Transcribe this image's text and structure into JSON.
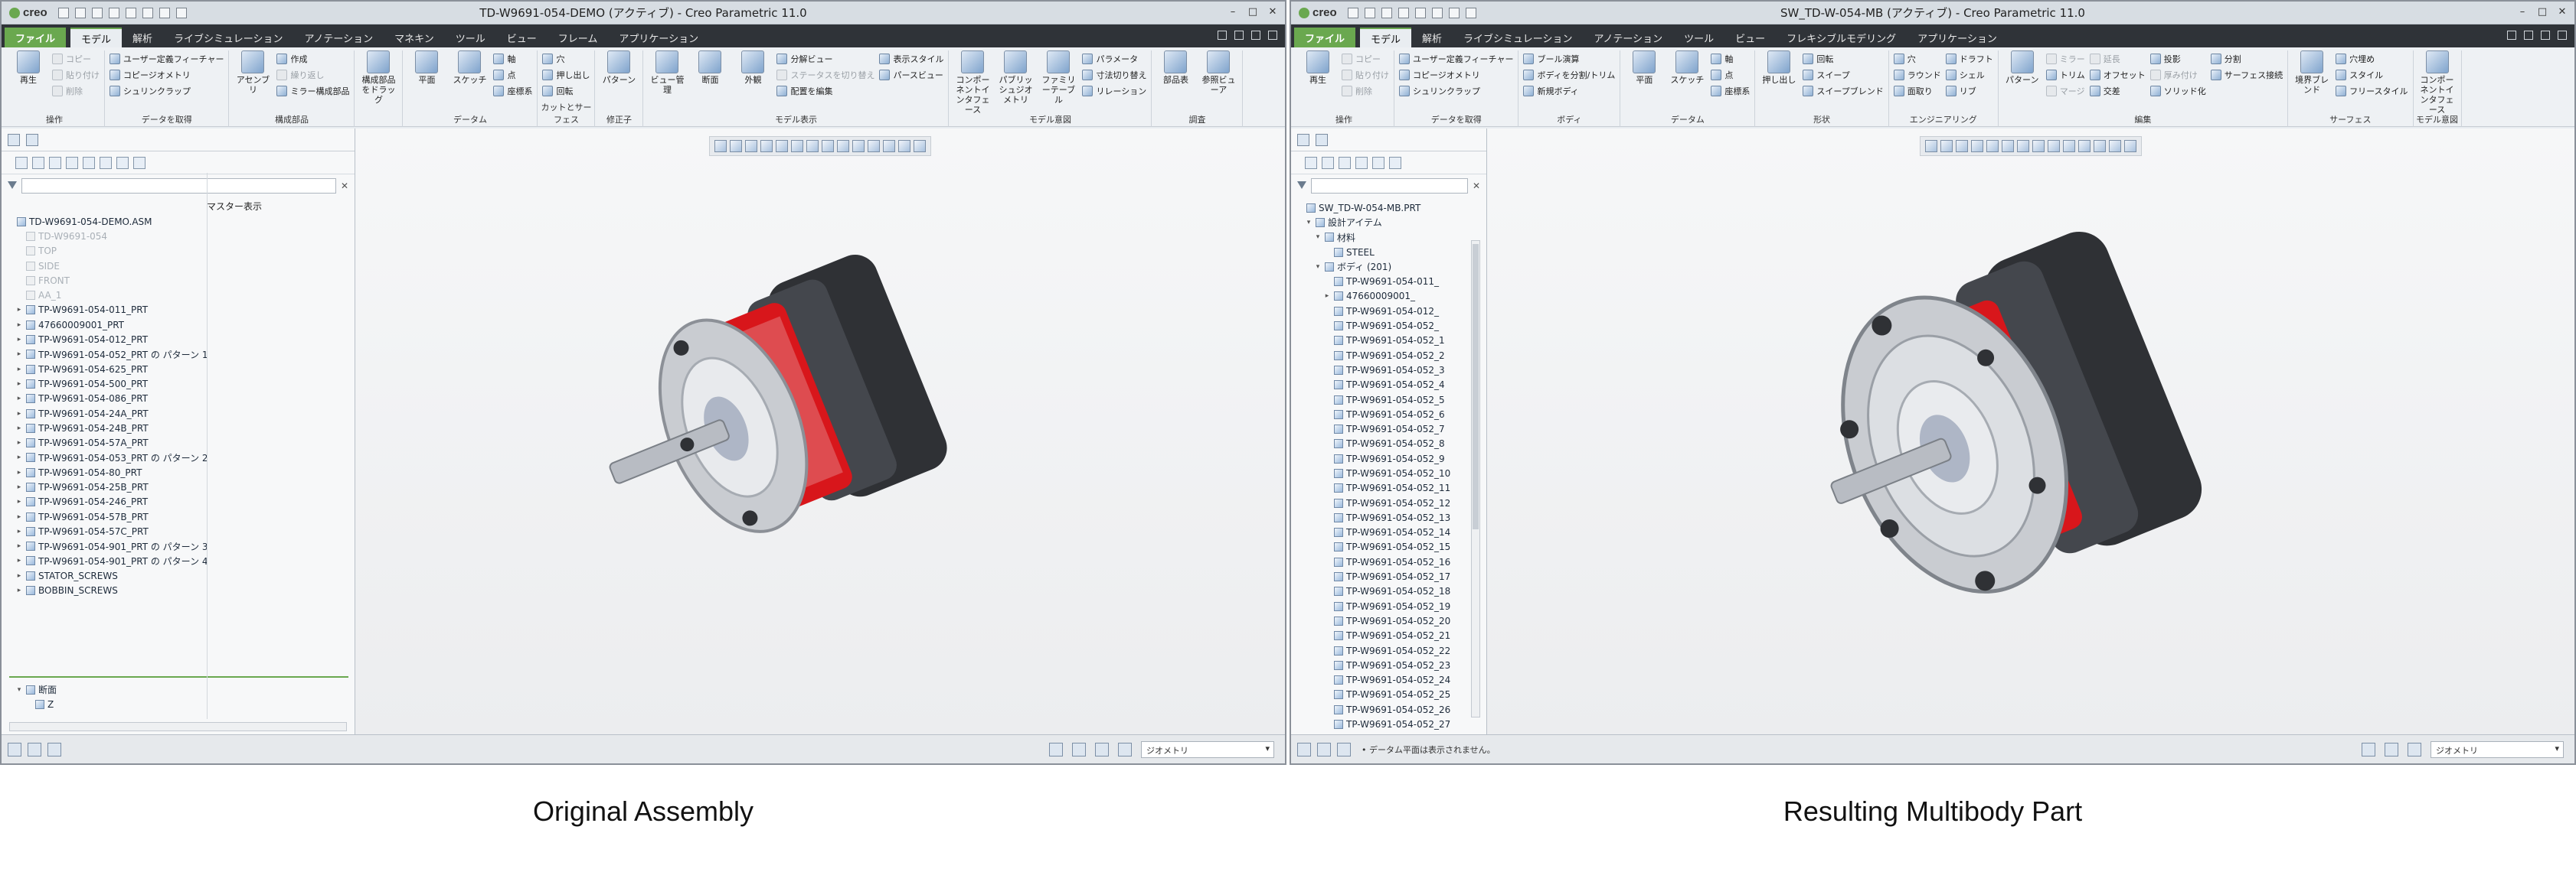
{
  "left_window": {
    "app": "creo",
    "title": "TD-W9691-054-DEMO (アクティブ) - Creo Parametric 11.0",
    "tabs": [
      {
        "label": "ファイル"
      },
      {
        "label": "モデル"
      },
      {
        "label": "解析"
      },
      {
        "label": "ライブシミュレーション"
      },
      {
        "label": "アノテーション"
      },
      {
        "label": "マネキン"
      },
      {
        "label": "ツール"
      },
      {
        "label": "ビュー"
      },
      {
        "label": "フレーム"
      },
      {
        "label": "アプリケーション"
      }
    ],
    "ribbon_groups": [
      {
        "label": "操作",
        "big": [
          {
            "label": "再生"
          }
        ],
        "small": [
          {
            "label": "コピー",
            "dim": true
          },
          {
            "label": "貼り付け",
            "dim": true
          },
          {
            "label": "削除",
            "dim": true
          }
        ]
      },
      {
        "label": "データを取得",
        "big": [],
        "small": [
          {
            "label": "ユーザー定義フィーチャー"
          },
          {
            "label": "コピージオメトリ"
          },
          {
            "label": "シュリンクラップ"
          }
        ]
      },
      {
        "label": "構成部品",
        "big": [
          {
            "label": "アセンブリ"
          }
        ],
        "small": [
          {
            "label": "作成"
          },
          {
            "label": "繰り返し",
            "dim": true
          },
          {
            "label": "ミラー構成部品"
          }
        ]
      },
      {
        "label": "",
        "big": [
          {
            "label": "構成部品をドラッグ"
          }
        ],
        "small": []
      },
      {
        "label": "データム",
        "big": [
          {
            "label": "平面"
          },
          {
            "label": "スケッチ"
          }
        ],
        "small": [
          {
            "label": "軸"
          },
          {
            "label": "点"
          },
          {
            "label": "座標系"
          }
        ]
      },
      {
        "label": "カットとサーフェス",
        "big": [],
        "small": [
          {
            "label": "穴"
          },
          {
            "label": "押し出し"
          },
          {
            "label": "回転"
          }
        ]
      },
      {
        "label": "修正子",
        "big": [
          {
            "label": "パターン"
          }
        ],
        "small": []
      },
      {
        "label": "モデル表示",
        "big": [
          {
            "label": "ビュー管理"
          },
          {
            "label": "断面"
          },
          {
            "label": "外観"
          }
        ],
        "small": [
          {
            "label": "分解ビュー"
          },
          {
            "label": "ステータスを切り替え",
            "dim": true
          },
          {
            "label": "配置を編集"
          },
          {
            "label": "表示スタイル"
          },
          {
            "label": "パースビュー"
          }
        ]
      },
      {
        "label": "モデル意図",
        "big": [
          {
            "label": "コンポーネントインタフェース"
          },
          {
            "label": "パブリッシュジオメトリ"
          },
          {
            "label": "ファミリーテーブル"
          }
        ],
        "small": [
          {
            "label": "パラメータ"
          },
          {
            "label": "寸法切り替え"
          },
          {
            "label": "リレーション"
          }
        ]
      },
      {
        "label": "調査",
        "big": [
          {
            "label": "部品表"
          },
          {
            "label": "参照ビューア"
          }
        ],
        "small": []
      }
    ],
    "tree_column_header": "マスター表示",
    "tree": [
      {
        "label": "TD-W9691-054-DEMO.ASM",
        "arrow": "",
        "ghost": false,
        "indent": 0
      },
      {
        "label": "TD-W9691-054",
        "arrow": "",
        "ghost": true,
        "indent": 1
      },
      {
        "label": "TOP",
        "arrow": "",
        "ghost": true,
        "indent": 1
      },
      {
        "label": "SIDE",
        "arrow": "",
        "ghost": true,
        "indent": 1
      },
      {
        "label": "FRONT",
        "arrow": "",
        "ghost": true,
        "indent": 1
      },
      {
        "label": "AA_1",
        "arrow": "",
        "ghost": true,
        "indent": 1
      },
      {
        "label": "TP-W9691-054-011_PRT",
        "arrow": "▸",
        "ghost": false,
        "indent": 1
      },
      {
        "label": "47660009001_PRT",
        "arrow": "▸",
        "ghost": false,
        "indent": 1
      },
      {
        "label": "TP-W9691-054-012_PRT",
        "arrow": "▸",
        "ghost": false,
        "indent": 1
      },
      {
        "label": "TP-W9691-054-052_PRT の パターン 1",
        "arrow": "▸",
        "ghost": false,
        "indent": 1
      },
      {
        "label": "TP-W9691-054-625_PRT",
        "arrow": "▸",
        "ghost": false,
        "indent": 1
      },
      {
        "label": "TP-W9691-054-500_PRT",
        "arrow": "▸",
        "ghost": false,
        "indent": 1
      },
      {
        "label": "TP-W9691-054-086_PRT",
        "arrow": "▸",
        "ghost": false,
        "indent": 1
      },
      {
        "label": "TP-W9691-054-24A_PRT",
        "arrow": "▸",
        "ghost": false,
        "indent": 1
      },
      {
        "label": "TP-W9691-054-24B_PRT",
        "arrow": "▸",
        "ghost": false,
        "indent": 1
      },
      {
        "label": "TP-W9691-054-57A_PRT",
        "arrow": "▸",
        "ghost": false,
        "indent": 1
      },
      {
        "label": "TP-W9691-054-053_PRT の パターン 2",
        "arrow": "▸",
        "ghost": false,
        "indent": 1
      },
      {
        "label": "TP-W9691-054-80_PRT",
        "arrow": "▸",
        "ghost": false,
        "indent": 1
      },
      {
        "label": "TP-W9691-054-25B_PRT",
        "arrow": "▸",
        "ghost": false,
        "indent": 1
      },
      {
        "label": "TP-W9691-054-246_PRT",
        "arrow": "▸",
        "ghost": false,
        "indent": 1
      },
      {
        "label": "TP-W9691-054-57B_PRT",
        "arrow": "▸",
        "ghost": false,
        "indent": 1
      },
      {
        "label": "TP-W9691-054-57C_PRT",
        "arrow": "▸",
        "ghost": false,
        "indent": 1
      },
      {
        "label": "TP-W9691-054-901_PRT の パターン 3",
        "arrow": "▸",
        "ghost": false,
        "indent": 1
      },
      {
        "label": "TP-W9691-054-901_PRT の パターン 4",
        "arrow": "▸",
        "ghost": false,
        "indent": 1
      },
      {
        "label": "STATOR_SCREWS",
        "arrow": "▸",
        "ghost": false,
        "indent": 1
      },
      {
        "label": "BOBBIN_SCREWS",
        "arrow": "▸",
        "ghost": false,
        "indent": 1
      }
    ],
    "section_tree": [
      {
        "label": "断面",
        "arrow": "▾",
        "ghost": false,
        "indent": 1
      },
      {
        "label": "Z",
        "arrow": "",
        "ghost": false,
        "indent": 2
      }
    ],
    "status_message": "",
    "filter_value": "ジオメトリ"
  },
  "right_window": {
    "app": "creo",
    "title": "SW_TD-W-054-MB (アクティブ) - Creo Parametric 11.0",
    "tabs": [
      {
        "label": "ファイル"
      },
      {
        "label": "モデル"
      },
      {
        "label": "解析"
      },
      {
        "label": "ライブシミュレーション"
      },
      {
        "label": "アノテーション"
      },
      {
        "label": "ツール"
      },
      {
        "label": "ビュー"
      },
      {
        "label": "フレキシブルモデリング"
      },
      {
        "label": "アプリケーション"
      }
    ],
    "ribbon_groups": [
      {
        "label": "操作",
        "big": [
          {
            "label": "再生"
          }
        ],
        "small": [
          {
            "label": "コピー",
            "dim": true
          },
          {
            "label": "貼り付け",
            "dim": true
          },
          {
            "label": "削除",
            "dim": true
          }
        ]
      },
      {
        "label": "データを取得",
        "big": [],
        "small": [
          {
            "label": "ユーザー定義フィーチャー"
          },
          {
            "label": "コピージオメトリ"
          },
          {
            "label": "シュリンクラップ"
          }
        ]
      },
      {
        "label": "ボディ",
        "big": [],
        "small": [
          {
            "label": "ブール演算"
          },
          {
            "label": "ボディを分割/トリム"
          },
          {
            "label": "新規ボディ"
          }
        ]
      },
      {
        "label": "データム",
        "big": [
          {
            "label": "平面"
          },
          {
            "label": "スケッチ"
          }
        ],
        "small": [
          {
            "label": "軸"
          },
          {
            "label": "点"
          },
          {
            "label": "座標系"
          }
        ]
      },
      {
        "label": "形状",
        "big": [
          {
            "label": "押し出し"
          }
        ],
        "small": [
          {
            "label": "回転"
          },
          {
            "label": "スイープ"
          },
          {
            "label": "スイープブレンド"
          }
        ]
      },
      {
        "label": "エンジニアリング",
        "big": [],
        "small": [
          {
            "label": "穴"
          },
          {
            "label": "ラウンド"
          },
          {
            "label": "面取り"
          },
          {
            "label": "ドラフト"
          },
          {
            "label": "シェル"
          },
          {
            "label": "リブ"
          }
        ]
      },
      {
        "label": "編集",
        "big": [
          {
            "label": "パターン"
          }
        ],
        "small": [
          {
            "label": "ミラー",
            "dim": true
          },
          {
            "label": "トリム"
          },
          {
            "label": "マージ",
            "dim": true
          },
          {
            "label": "延長",
            "dim": true
          },
          {
            "label": "オフセット"
          },
          {
            "label": "交差"
          },
          {
            "label": "投影"
          },
          {
            "label": "厚み付け",
            "dim": true
          },
          {
            "label": "ソリッド化"
          },
          {
            "label": "分割"
          },
          {
            "label": "サーフェス接続"
          }
        ]
      },
      {
        "label": "サーフェス",
        "big": [
          {
            "label": "境界ブレンド"
          }
        ],
        "small": [
          {
            "label": "穴埋め"
          },
          {
            "label": "スタイル"
          },
          {
            "label": "フリースタイル"
          }
        ]
      },
      {
        "label": "モデル意図",
        "big": [
          {
            "label": "コンポーネントインタフェース"
          }
        ],
        "small": []
      }
    ],
    "tree_column_header": "",
    "tree": [
      {
        "label": "SW_TD-W-054-MB.PRT",
        "arrow": "",
        "ghost": false,
        "indent": 0
      },
      {
        "label": "設計アイテム",
        "arrow": "▾",
        "ghost": false,
        "indent": 1
      },
      {
        "label": "材料",
        "arrow": "▾",
        "ghost": false,
        "indent": 2
      },
      {
        "label": "STEEL",
        "arrow": "",
        "ghost": false,
        "indent": 3
      },
      {
        "label": "ボディ (201)",
        "arrow": "▾",
        "ghost": false,
        "indent": 2
      },
      {
        "label": "TP-W9691-054-011_",
        "arrow": "",
        "ghost": false,
        "indent": 3
      },
      {
        "label": "47660009001_",
        "arrow": "▸",
        "ghost": false,
        "indent": 3
      },
      {
        "label": "TP-W9691-054-012_",
        "arrow": "",
        "ghost": false,
        "indent": 3
      },
      {
        "label": "TP-W9691-054-052_",
        "arrow": "",
        "ghost": false,
        "indent": 3
      },
      {
        "label": "TP-W9691-054-052_1",
        "arrow": "",
        "ghost": false,
        "indent": 3
      },
      {
        "label": "TP-W9691-054-052_2",
        "arrow": "",
        "ghost": false,
        "indent": 3
      },
      {
        "label": "TP-W9691-054-052_3",
        "arrow": "",
        "ghost": false,
        "indent": 3
      },
      {
        "label": "TP-W9691-054-052_4",
        "arrow": "",
        "ghost": false,
        "indent": 3
      },
      {
        "label": "TP-W9691-054-052_5",
        "arrow": "",
        "ghost": false,
        "indent": 3
      },
      {
        "label": "TP-W9691-054-052_6",
        "arrow": "",
        "ghost": false,
        "indent": 3
      },
      {
        "label": "TP-W9691-054-052_7",
        "arrow": "",
        "ghost": false,
        "indent": 3
      },
      {
        "label": "TP-W9691-054-052_8",
        "arrow": "",
        "ghost": false,
        "indent": 3
      },
      {
        "label": "TP-W9691-054-052_9",
        "arrow": "",
        "ghost": false,
        "indent": 3
      },
      {
        "label": "TP-W9691-054-052_10",
        "arrow": "",
        "ghost": false,
        "indent": 3
      },
      {
        "label": "TP-W9691-054-052_11",
        "arrow": "",
        "ghost": false,
        "indent": 3
      },
      {
        "label": "TP-W9691-054-052_12",
        "arrow": "",
        "ghost": false,
        "indent": 3
      },
      {
        "label": "TP-W9691-054-052_13",
        "arrow": "",
        "ghost": false,
        "indent": 3
      },
      {
        "label": "TP-W9691-054-052_14",
        "arrow": "",
        "ghost": false,
        "indent": 3
      },
      {
        "label": "TP-W9691-054-052_15",
        "arrow": "",
        "ghost": false,
        "indent": 3
      },
      {
        "label": "TP-W9691-054-052_16",
        "arrow": "",
        "ghost": false,
        "indent": 3
      },
      {
        "label": "TP-W9691-054-052_17",
        "arrow": "",
        "ghost": false,
        "indent": 3
      },
      {
        "label": "TP-W9691-054-052_18",
        "arrow": "",
        "ghost": false,
        "indent": 3
      },
      {
        "label": "TP-W9691-054-052_19",
        "arrow": "",
        "ghost": false,
        "indent": 3
      },
      {
        "label": "TP-W9691-054-052_20",
        "arrow": "",
        "ghost": false,
        "indent": 3
      },
      {
        "label": "TP-W9691-054-052_21",
        "arrow": "",
        "ghost": false,
        "indent": 3
      },
      {
        "label": "TP-W9691-054-052_22",
        "arrow": "",
        "ghost": false,
        "indent": 3
      },
      {
        "label": "TP-W9691-054-052_23",
        "arrow": "",
        "ghost": false,
        "indent": 3
      },
      {
        "label": "TP-W9691-054-052_24",
        "arrow": "",
        "ghost": false,
        "indent": 3
      },
      {
        "label": "TP-W9691-054-052_25",
        "arrow": "",
        "ghost": false,
        "indent": 3
      },
      {
        "label": "TP-W9691-054-052_26",
        "arrow": "",
        "ghost": false,
        "indent": 3
      },
      {
        "label": "TP-W9691-054-052_27",
        "arrow": "",
        "ghost": false,
        "indent": 3
      }
    ],
    "section_tree": [],
    "status_message": "• データム平面は表示されません。",
    "filter_value": "ジオメトリ"
  },
  "captions": {
    "left": "Original Assembly",
    "right": "Resulting Multibody Part"
  },
  "colors": {
    "accent_green": "#6aa84f",
    "tab_bar": "#2f3338",
    "motor_red": "#d8161b",
    "motor_dark": "#3d3f44",
    "motor_silver": "#c9ccd1"
  }
}
